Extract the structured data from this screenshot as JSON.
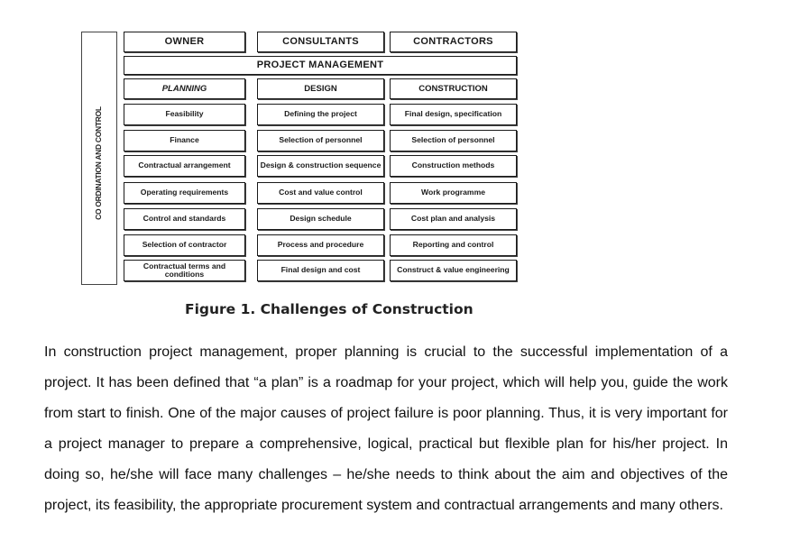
{
  "figure": {
    "side_label": "CO ORDINATION AND CONTROL",
    "headers": [
      "OWNER",
      "CONSULTANTS",
      "CONTRACTORS"
    ],
    "project_management": "PROJECT MANAGEMENT",
    "phases": [
      "PLANNING",
      "DESIGN",
      "CONSTRUCTION"
    ],
    "rows": [
      [
        "Feasibility",
        "Defining the project",
        "Final design, specification"
      ],
      [
        "Finance",
        "Selection of personnel",
        "Selection of personnel"
      ],
      [
        "Contractual arrangement",
        "Design & construction sequence",
        "Construction methods"
      ],
      [
        "Operating requirements",
        "Cost and value control",
        "Work programme"
      ],
      [
        "Control and standards",
        "Design schedule",
        "Cost plan and analysis"
      ],
      [
        "Selection of contractor",
        "Process and procedure",
        "Reporting and control"
      ],
      [
        "Contractual terms and conditions",
        "Final design and cost",
        "Construct & value engineering"
      ]
    ],
    "caption": "Figure 1. Challenges of Construction"
  },
  "body_text": "In construction project management, proper planning is crucial to the successful implementation of a project. It has been defined that “a plan” is a roadmap for your project, which will help you, guide the work from start to finish. One of the major causes of project failure is poor planning. Thus, it is very important for a project manager to prepare a comprehensive, logical, practical but flexible plan for his/her project. In doing so, he/she will face many challenges – he/she needs to think about the aim and objectives of the project, its feasibility, the appropriate procurement system and contractual arrangements and many others."
}
